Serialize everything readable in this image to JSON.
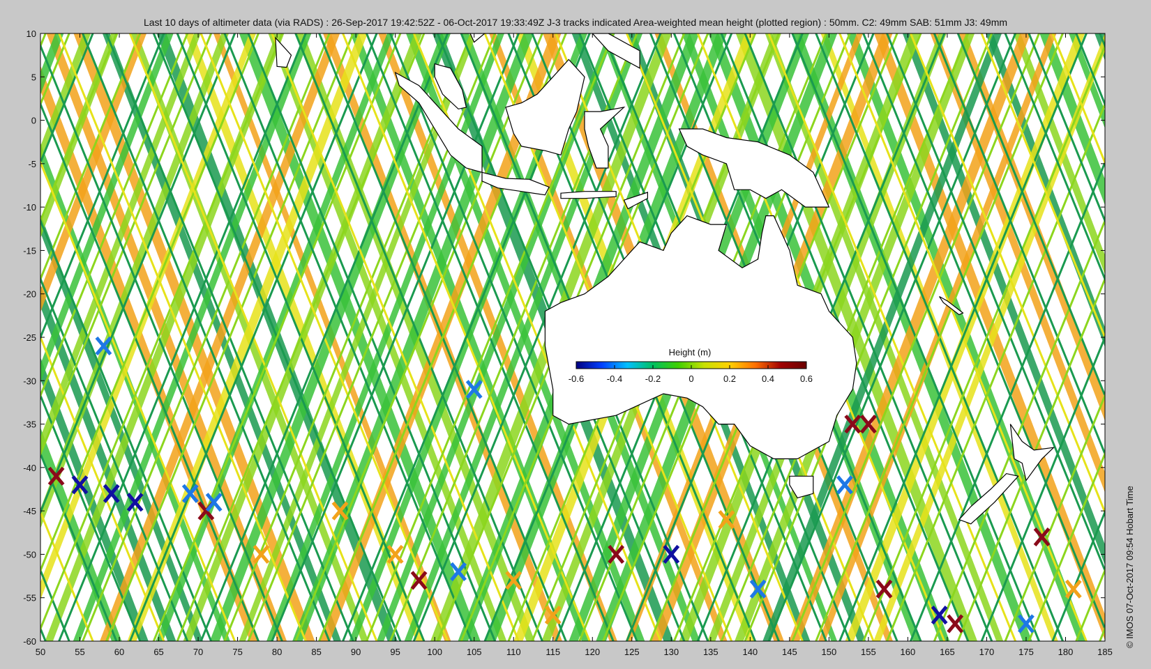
{
  "title": "Last 10 days of altimeter data (via RADS) : 26-Sep-2017 19:42:52Z - 06-Oct-2017 19:33:49Z  J-3 tracks indicated  Area-weighted mean height (plotted region) : 50mm.  C2: 49mm  SAB: 51mm  J3: 49mm",
  "credit": "© IMOS 07-Oct-2017 09:54 Hobart Time",
  "map": {
    "lon_range": [
      50,
      185
    ],
    "lat_range": [
      -60,
      10
    ],
    "x_ticks": [
      "50",
      "55",
      "60",
      "65",
      "70",
      "75",
      "80",
      "85",
      "90",
      "95",
      "100",
      "105",
      "110",
      "115",
      "120",
      "125",
      "130",
      "135",
      "140",
      "145",
      "150",
      "155",
      "160",
      "165",
      "170",
      "175",
      "180",
      "185"
    ],
    "y_ticks": [
      "10",
      "5",
      "0",
      "-5",
      "-10",
      "-15",
      "-20",
      "-25",
      "-30",
      "-35",
      "-40",
      "-45",
      "-50",
      "-55",
      "-60"
    ],
    "land_color": "#ffffff",
    "coast_color": "#000000"
  },
  "colorbar": {
    "title": "Height (m)",
    "tick_labels": [
      "-0.6",
      "-0.4",
      "-0.2",
      "0",
      "0.2",
      "0.4",
      "0.6"
    ],
    "colors": [
      "#00007f",
      "#0040ff",
      "#00bfff",
      "#00c060",
      "#40d000",
      "#c8e000",
      "#ffd000",
      "#ff7000",
      "#a00000",
      "#6a0000"
    ]
  },
  "track_colors": {
    "dark_green": "#1a9a50",
    "green": "#39c23a",
    "lime": "#8cd61e",
    "yellow": "#e6e21a",
    "orange": "#f2a21a",
    "blue": "#1e78e6",
    "navy": "#1010a0",
    "darkred": "#8a0a1a"
  }
}
